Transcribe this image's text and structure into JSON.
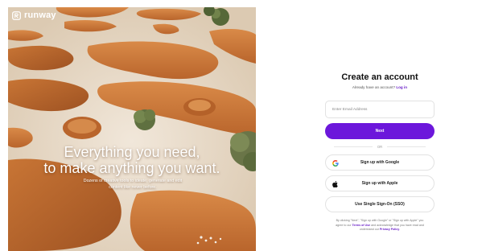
{
  "brand": {
    "name": "runway",
    "logo_icon": "runway-logo-icon"
  },
  "hero": {
    "headline_line1": "Everything you need,",
    "headline_line2": "to make anything you want.",
    "subtext_line1": "Dozens of creative tools to ideate, generate and edit",
    "subtext_line2": "content like never before."
  },
  "signup": {
    "title": "Create an account",
    "already_text": "Already have an account?",
    "login_link": "Log in",
    "email_placeholder": "Enter Email Address",
    "next_label": "Next",
    "or_label": "OR",
    "google_label": "Sign up with Google",
    "google_icon": "google-icon",
    "apple_label": "Sign up with Apple",
    "apple_icon": "apple-icon",
    "sso_label": "Use Single Sign-On (SSO)",
    "terms_line1": "By clicking \"Next\", \"Sign up with Google\" or \"Sign up with Apple\" you",
    "terms_prefix": "agree to our",
    "terms_link": "Terms of Use",
    "terms_middle": "and acknowledge that you have read and",
    "terms_line3_prefix": "understand our",
    "privacy_link": "Privacy Policy",
    "terms_line3_suffix": "."
  },
  "colors": {
    "accent": "#6c17db",
    "link": "#6b21c8",
    "sand": "#e3d4bf",
    "dune_orange": "#c9773a"
  }
}
